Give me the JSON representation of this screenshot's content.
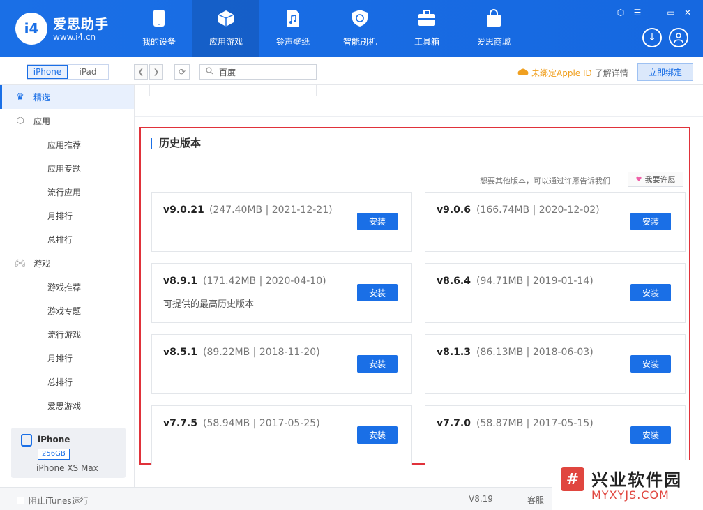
{
  "header": {
    "logo_text": "i4",
    "brand_name": "爱思助手",
    "brand_url": "www.i4.cn",
    "nav": [
      {
        "label": "我的设备",
        "icon": "phone-icon"
      },
      {
        "label": "应用游戏",
        "icon": "cube-icon"
      },
      {
        "label": "铃声壁纸",
        "icon": "music-file-icon"
      },
      {
        "label": "智能刷机",
        "icon": "shield-refresh-icon"
      },
      {
        "label": "工具箱",
        "icon": "toolbox-icon"
      },
      {
        "label": "爱思商城",
        "icon": "shopping-bag-icon"
      }
    ],
    "active_nav": 1,
    "accent": "#1a6fe6"
  },
  "toolbar": {
    "device_tabs": [
      "iPhone",
      "iPad"
    ],
    "search_value": "百度",
    "apple_id_status": "未绑定Apple ID",
    "learn_more": "了解详情",
    "bind_button": "立即绑定"
  },
  "sidebar": {
    "items": [
      {
        "label": "精选",
        "level": "top",
        "icon": "crown-icon",
        "selected": true
      },
      {
        "label": "应用",
        "level": "top",
        "icon": "app-store-icon"
      },
      {
        "label": "应用推荐",
        "level": "sub"
      },
      {
        "label": "应用专题",
        "level": "sub"
      },
      {
        "label": "流行应用",
        "level": "sub"
      },
      {
        "label": "月排行",
        "level": "sub"
      },
      {
        "label": "总排行",
        "level": "sub"
      },
      {
        "label": "游戏",
        "level": "top",
        "icon": "gamepad-icon"
      },
      {
        "label": "游戏推荐",
        "level": "sub"
      },
      {
        "label": "游戏专题",
        "level": "sub"
      },
      {
        "label": "流行游戏",
        "level": "sub"
      },
      {
        "label": "月排行",
        "level": "sub"
      },
      {
        "label": "总排行",
        "level": "sub"
      },
      {
        "label": "爱思游戏",
        "level": "sub"
      }
    ],
    "device": {
      "name": "iPhone",
      "capacity": "256GB",
      "model": "iPhone XS Max"
    }
  },
  "history": {
    "title": "历史版本",
    "wish_text": "想要其他版本，可以通过许愿告诉我们",
    "wish_button": "我要许愿",
    "install_label": "安装",
    "versions": [
      {
        "version": "v9.0.21",
        "meta": "(247.40MB | 2021-12-21)",
        "note": ""
      },
      {
        "version": "v9.0.6",
        "meta": "(166.74MB | 2020-12-02)",
        "note": ""
      },
      {
        "version": "v8.9.1",
        "meta": "(171.42MB | 2020-04-10)",
        "note": "可提供的最高历史版本"
      },
      {
        "version": "v8.6.4",
        "meta": "(94.71MB | 2019-01-14)",
        "note": ""
      },
      {
        "version": "v8.5.1",
        "meta": "(89.22MB | 2018-11-20)",
        "note": ""
      },
      {
        "version": "v8.1.3",
        "meta": "(86.13MB | 2018-06-03)",
        "note": ""
      },
      {
        "version": "v7.7.5",
        "meta": "(58.94MB | 2017-05-25)",
        "note": ""
      },
      {
        "version": "v7.7.0",
        "meta": "(58.87MB | 2017-05-15)",
        "note": ""
      }
    ]
  },
  "footer": {
    "itunes_label": "阻止iTunes运行",
    "version": "V8.19",
    "service": "客服"
  },
  "watermark": {
    "logo": "#",
    "title": "兴业软件园",
    "url": "MYXYJS.COM"
  }
}
